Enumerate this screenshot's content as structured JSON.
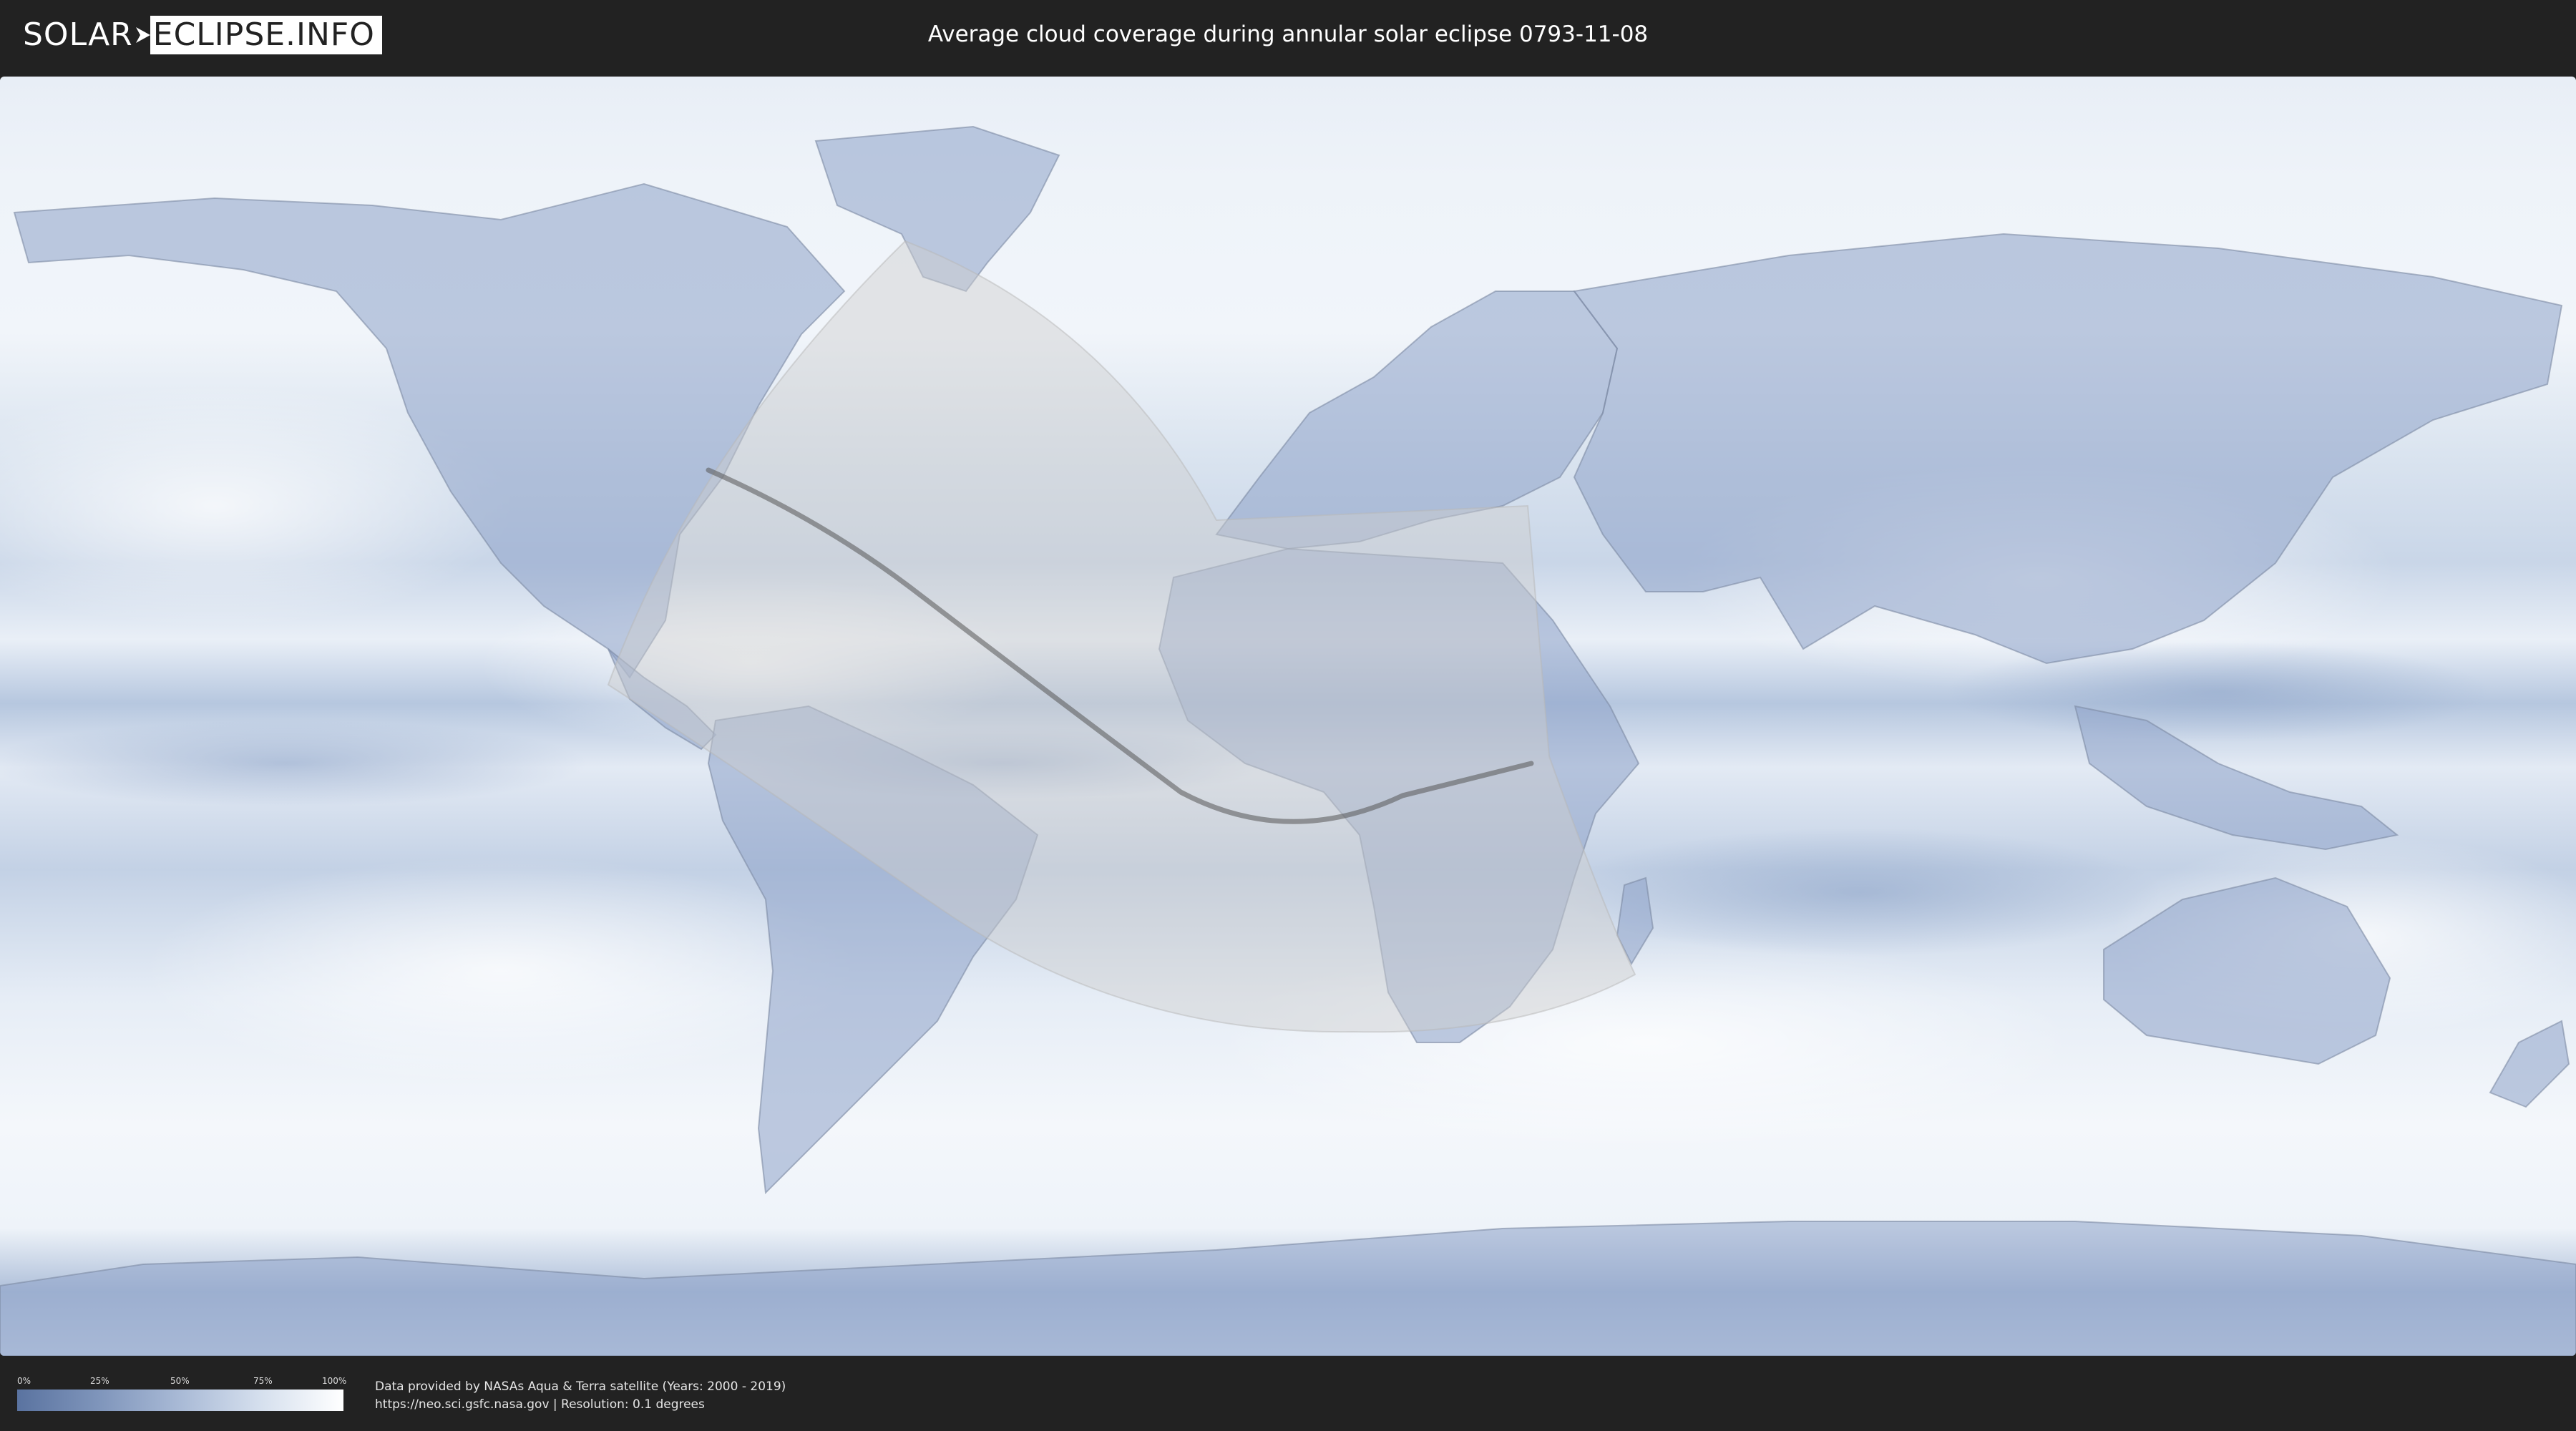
{
  "header": {
    "logo_part1": "SOLAR",
    "logo_part2": "ECLIPSE.INFO",
    "title": "Average cloud coverage during annular solar eclipse 0793-11-08"
  },
  "map": {
    "projection": "equirectangular",
    "layer": "average cloud coverage",
    "colors": {
      "clear_sky": "#5a73a0",
      "full_cloud": "#ffffff",
      "visibility_zone": "#cfcfcf",
      "central_path": "#555555"
    }
  },
  "legend": {
    "ticks": [
      "0%",
      "25%",
      "50%",
      "75%",
      "100%"
    ]
  },
  "credits": {
    "line1": "Data provided by NASAs Aqua & Terra satellite (Years: 2000 - 2019)",
    "line2": "https://neo.sci.gsfc.nasa.gov | Resolution: 0.1 degrees"
  }
}
